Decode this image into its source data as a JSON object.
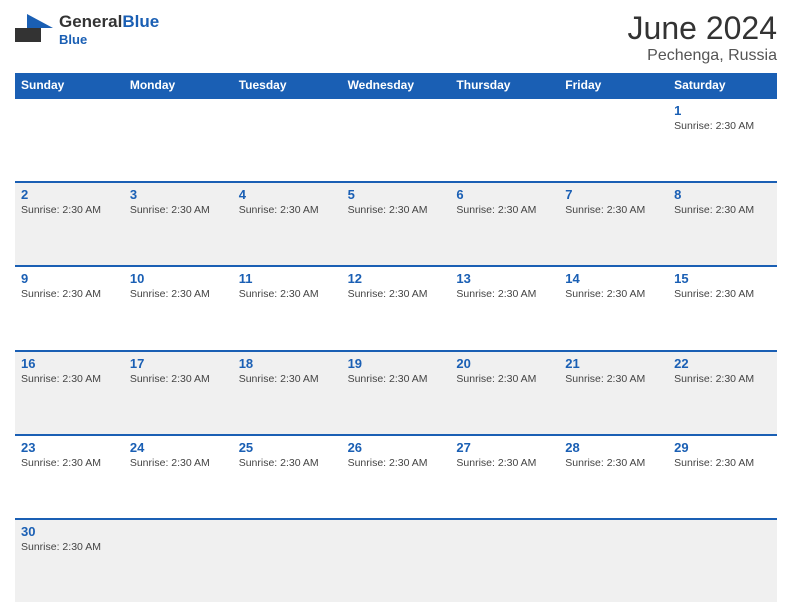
{
  "header": {
    "logo_general": "General",
    "logo_blue": "Blue",
    "month_year": "June 2024",
    "location": "Pechenga, Russia"
  },
  "weekdays": [
    "Sunday",
    "Monday",
    "Tuesday",
    "Wednesday",
    "Thursday",
    "Friday",
    "Saturday"
  ],
  "rows": [
    [
      {
        "day": "",
        "info": ""
      },
      {
        "day": "",
        "info": ""
      },
      {
        "day": "",
        "info": ""
      },
      {
        "day": "",
        "info": ""
      },
      {
        "day": "",
        "info": ""
      },
      {
        "day": "",
        "info": ""
      },
      {
        "day": "1",
        "info": "Sunrise: 2:30 AM"
      }
    ],
    [
      {
        "day": "2",
        "info": "Sunrise: 2:30 AM"
      },
      {
        "day": "3",
        "info": "Sunrise: 2:30 AM"
      },
      {
        "day": "4",
        "info": "Sunrise: 2:30 AM"
      },
      {
        "day": "5",
        "info": "Sunrise: 2:30 AM"
      },
      {
        "day": "6",
        "info": "Sunrise: 2:30 AM"
      },
      {
        "day": "7",
        "info": "Sunrise: 2:30 AM"
      },
      {
        "day": "8",
        "info": "Sunrise: 2:30 AM"
      }
    ],
    [
      {
        "day": "9",
        "info": "Sunrise: 2:30 AM"
      },
      {
        "day": "10",
        "info": "Sunrise: 2:30 AM"
      },
      {
        "day": "11",
        "info": "Sunrise: 2:30 AM"
      },
      {
        "day": "12",
        "info": "Sunrise: 2:30 AM"
      },
      {
        "day": "13",
        "info": "Sunrise: 2:30 AM"
      },
      {
        "day": "14",
        "info": "Sunrise: 2:30 AM"
      },
      {
        "day": "15",
        "info": "Sunrise: 2:30 AM"
      }
    ],
    [
      {
        "day": "16",
        "info": "Sunrise: 2:30 AM"
      },
      {
        "day": "17",
        "info": "Sunrise: 2:30 AM"
      },
      {
        "day": "18",
        "info": "Sunrise: 2:30 AM"
      },
      {
        "day": "19",
        "info": "Sunrise: 2:30 AM"
      },
      {
        "day": "20",
        "info": "Sunrise: 2:30 AM"
      },
      {
        "day": "21",
        "info": "Sunrise: 2:30 AM"
      },
      {
        "day": "22",
        "info": "Sunrise: 2:30 AM"
      }
    ],
    [
      {
        "day": "23",
        "info": "Sunrise: 2:30 AM"
      },
      {
        "day": "24",
        "info": "Sunrise: 2:30 AM"
      },
      {
        "day": "25",
        "info": "Sunrise: 2:30 AM"
      },
      {
        "day": "26",
        "info": "Sunrise: 2:30 AM"
      },
      {
        "day": "27",
        "info": "Sunrise: 2:30 AM"
      },
      {
        "day": "28",
        "info": "Sunrise: 2:30 AM"
      },
      {
        "day": "29",
        "info": "Sunrise: 2:30 AM"
      }
    ],
    [
      {
        "day": "30",
        "info": "Sunrise: 2:30 AM"
      },
      {
        "day": "",
        "info": ""
      },
      {
        "day": "",
        "info": ""
      },
      {
        "day": "",
        "info": ""
      },
      {
        "day": "",
        "info": ""
      },
      {
        "day": "",
        "info": ""
      },
      {
        "day": "",
        "info": ""
      }
    ]
  ],
  "colors": {
    "header_bg": "#1a5fb4",
    "header_text": "#ffffff",
    "accent": "#1a5fb4",
    "border": "#1a5fb4"
  }
}
